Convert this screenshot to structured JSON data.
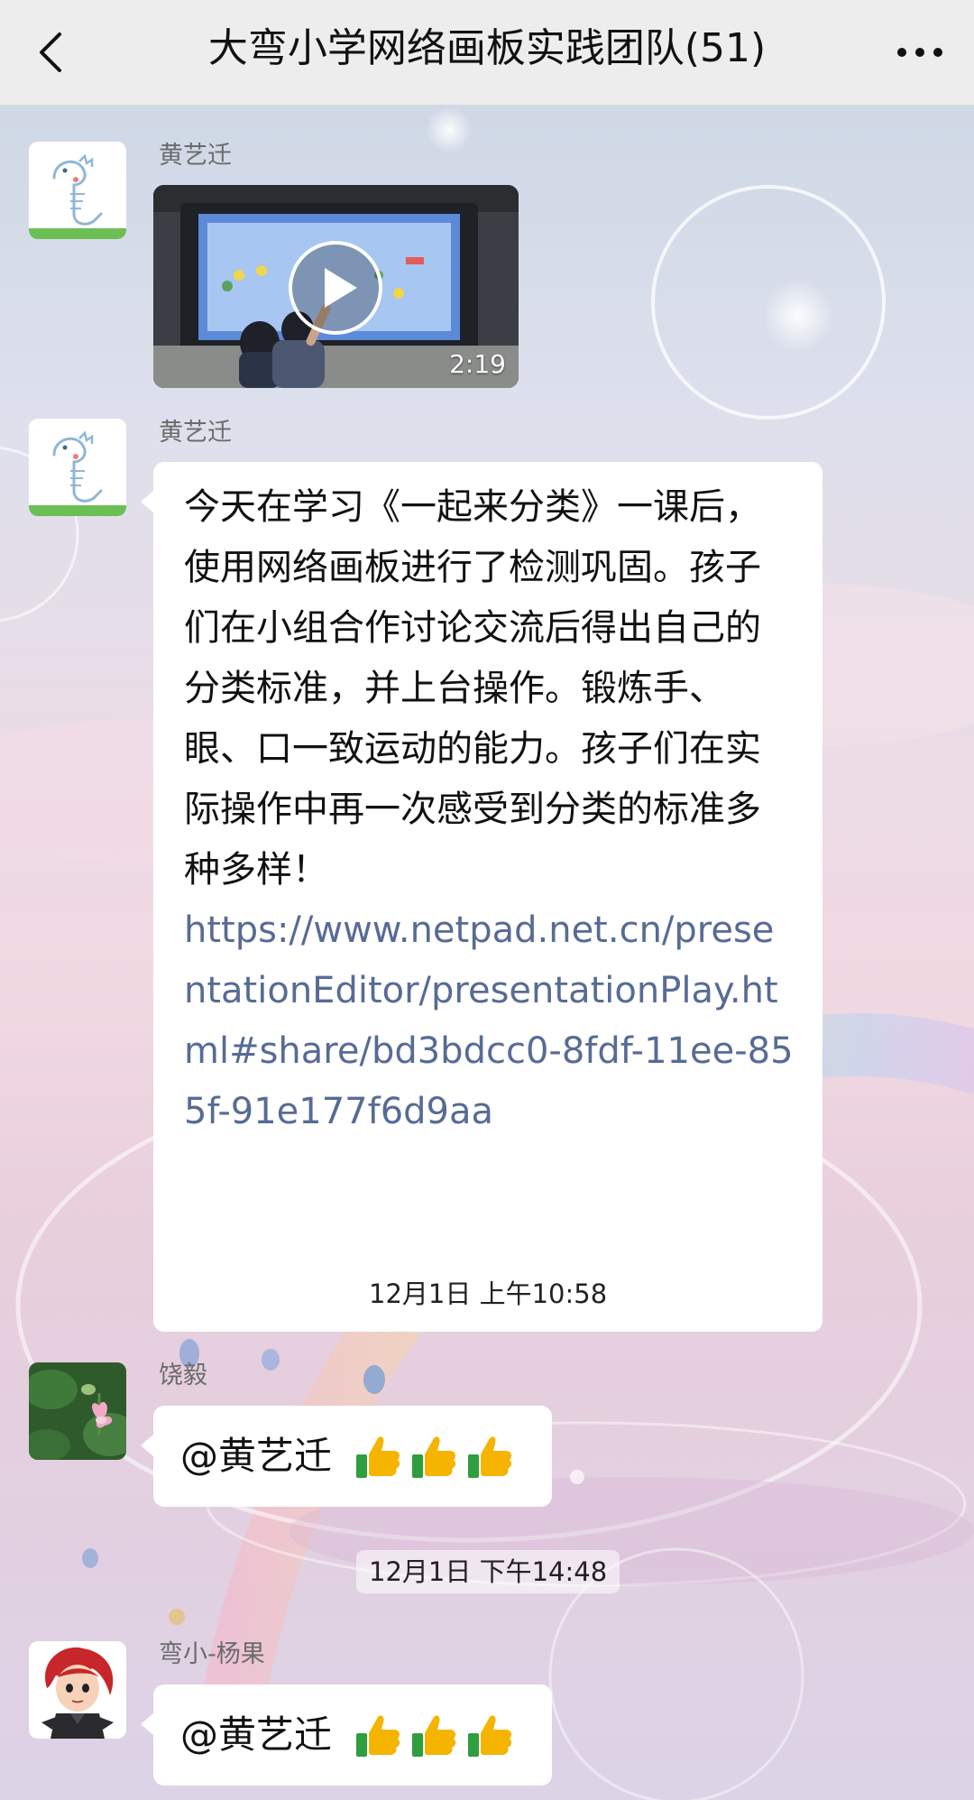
{
  "header": {
    "title": "大弯小学网络画板实践团队(51)"
  },
  "messages": [
    {
      "sender": "黄艺迁",
      "type": "video",
      "duration": "2:19"
    },
    {
      "sender": "黄艺迁",
      "type": "text",
      "text": "今天在学习《一起来分类》一课后，使用网络画板进行了检测巩固。孩子们在小组合作讨论交流后得出自己的分类标准，并上台操作。锻炼手、眼、口一致运动的能力。孩子们在实际操作中再一次感受到分类的标准多种多样！",
      "link": "https://www.netpad.net.cn/presentationEditor/presentationPlay.html#share/bd3bdcc0-8fdf-11ee-855f-91e177f6d9aa"
    },
    {
      "timestamp": "12月1日 上午10:58"
    },
    {
      "sender": "饶毅",
      "type": "mention",
      "text": "@黄艺迁",
      "emoji": [
        "thumbs-up",
        "thumbs-up",
        "thumbs-up"
      ]
    },
    {
      "timestamp": "12月1日 下午14:48"
    },
    {
      "sender": "弯小-杨果",
      "type": "mention",
      "text": "@黄艺迁",
      "emoji": [
        "thumbs-up",
        "thumbs-up",
        "thumbs-up"
      ]
    }
  ],
  "colors": {
    "link": "#576b95",
    "header_bg": "#ededed",
    "bubble_bg": "#ffffff",
    "thumb_yellow": "#f4b400",
    "thumb_green": "#2e9e3e"
  }
}
